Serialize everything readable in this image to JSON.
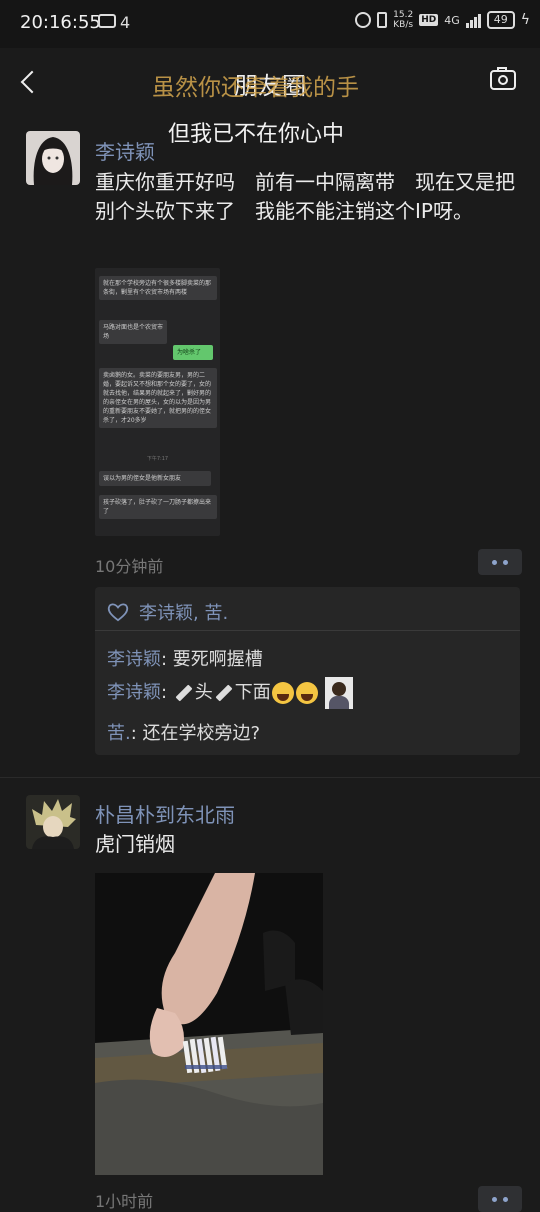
{
  "status_bar": {
    "time": "20:16:55",
    "notification_count": "4",
    "net_speed_value": "15.2",
    "net_speed_unit": "KB/s",
    "network": "4G",
    "hd_label": "HD",
    "battery": "49"
  },
  "header": {
    "title": "朋友圈",
    "lyric_line_1": "虽然你还牵着我的手",
    "lyric_line_2": "但我已不在你心中"
  },
  "posts": [
    {
      "author": "李诗颖",
      "text": "重庆你重开好吗　前有一中隔离带　现在又是把别个头砍下来了　我能不能注销这个IP呀。",
      "time_ago": "10分钟前",
      "chat_image": {
        "messages": [
          "就在那个学校旁边有个很多楼脚卖菜的那条街，剿里有个农贸市场有两楼",
          "马路对面也是个农贸市场",
          "为啥杀了",
          "卖卤鹅的女。卖菜的要朋友男，男的二婚，要起诉又不想和那个女的要了，女的就去找他，结果男的就起来了，剿好男的的亲侄女在男的屋头，女的以为是因为男的重新要朋友不要她了，就把男的的侄女杀了，才20多岁",
          "下午7:17",
          "误以为男的侄女是他新女朋友",
          "孩子砍落了，肚子砍了一刀肠子都撩出来了"
        ]
      },
      "likes": "李诗颖, 苦.",
      "comments": [
        {
          "author": "李诗颖",
          "text": "要死啊握槽"
        },
        {
          "author": "李诗颖",
          "text_parts": [
            "头",
            "下面"
          ]
        },
        {
          "author": "苦.",
          "text": "还在学校旁边?"
        }
      ]
    },
    {
      "author": "朴昌朴到东北雨",
      "text": "虎门销烟",
      "time_ago": "1小时前"
    }
  ],
  "colors": {
    "background": "#1b1b1b",
    "name_blue": "#7f93b8",
    "lyric_gold": "#d4a64e",
    "wechat_green": "#63c76d"
  }
}
